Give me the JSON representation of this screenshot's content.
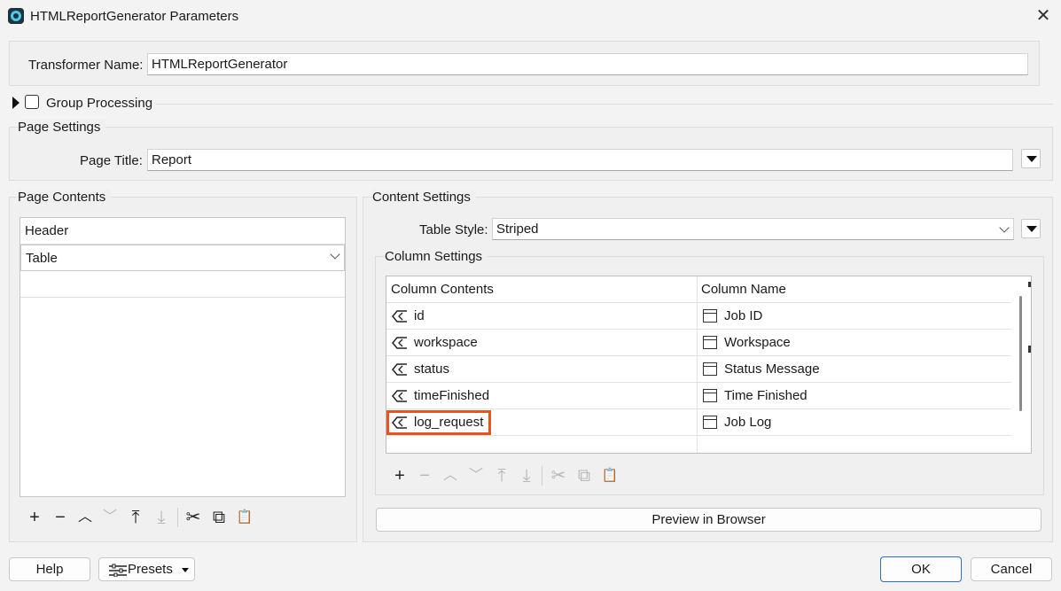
{
  "window": {
    "title": "HTMLReportGenerator Parameters",
    "close_glyph": "✕"
  },
  "transformer": {
    "label": "Transformer Name:",
    "value": "HTMLReportGenerator"
  },
  "group_processing": {
    "label": "Group Processing"
  },
  "page_settings": {
    "title": "Page Settings",
    "page_title_label": "Page Title:",
    "page_title_value": "Report"
  },
  "page_contents": {
    "title": "Page Contents",
    "items": [
      "Header",
      "Table"
    ]
  },
  "content_settings": {
    "title": "Content Settings",
    "table_style_label": "Table Style:",
    "table_style_value": "Striped",
    "column_settings": {
      "title": "Column Settings",
      "headers": [
        "Column Contents",
        "Column Name"
      ],
      "rows": [
        {
          "content": "id",
          "name": "Job ID"
        },
        {
          "content": "workspace",
          "name": "Workspace"
        },
        {
          "content": "status",
          "name": "Status Message"
        },
        {
          "content": "timeFinished",
          "name": "Time Finished"
        },
        {
          "content": "log_request",
          "name": "Job Log"
        }
      ],
      "highlight_color": "#e8541c"
    },
    "preview_button": "Preview in Browser"
  },
  "toolbar_glyphs": {
    "add": "+",
    "remove": "−",
    "up": "︿",
    "down": "﹀",
    "top": "⤒",
    "bottom": "⤓",
    "cut": "✂",
    "copy": "⧉",
    "paste": "📋"
  },
  "footer": {
    "help": "Help",
    "presets": "Presets",
    "ok": "OK",
    "cancel": "Cancel"
  }
}
